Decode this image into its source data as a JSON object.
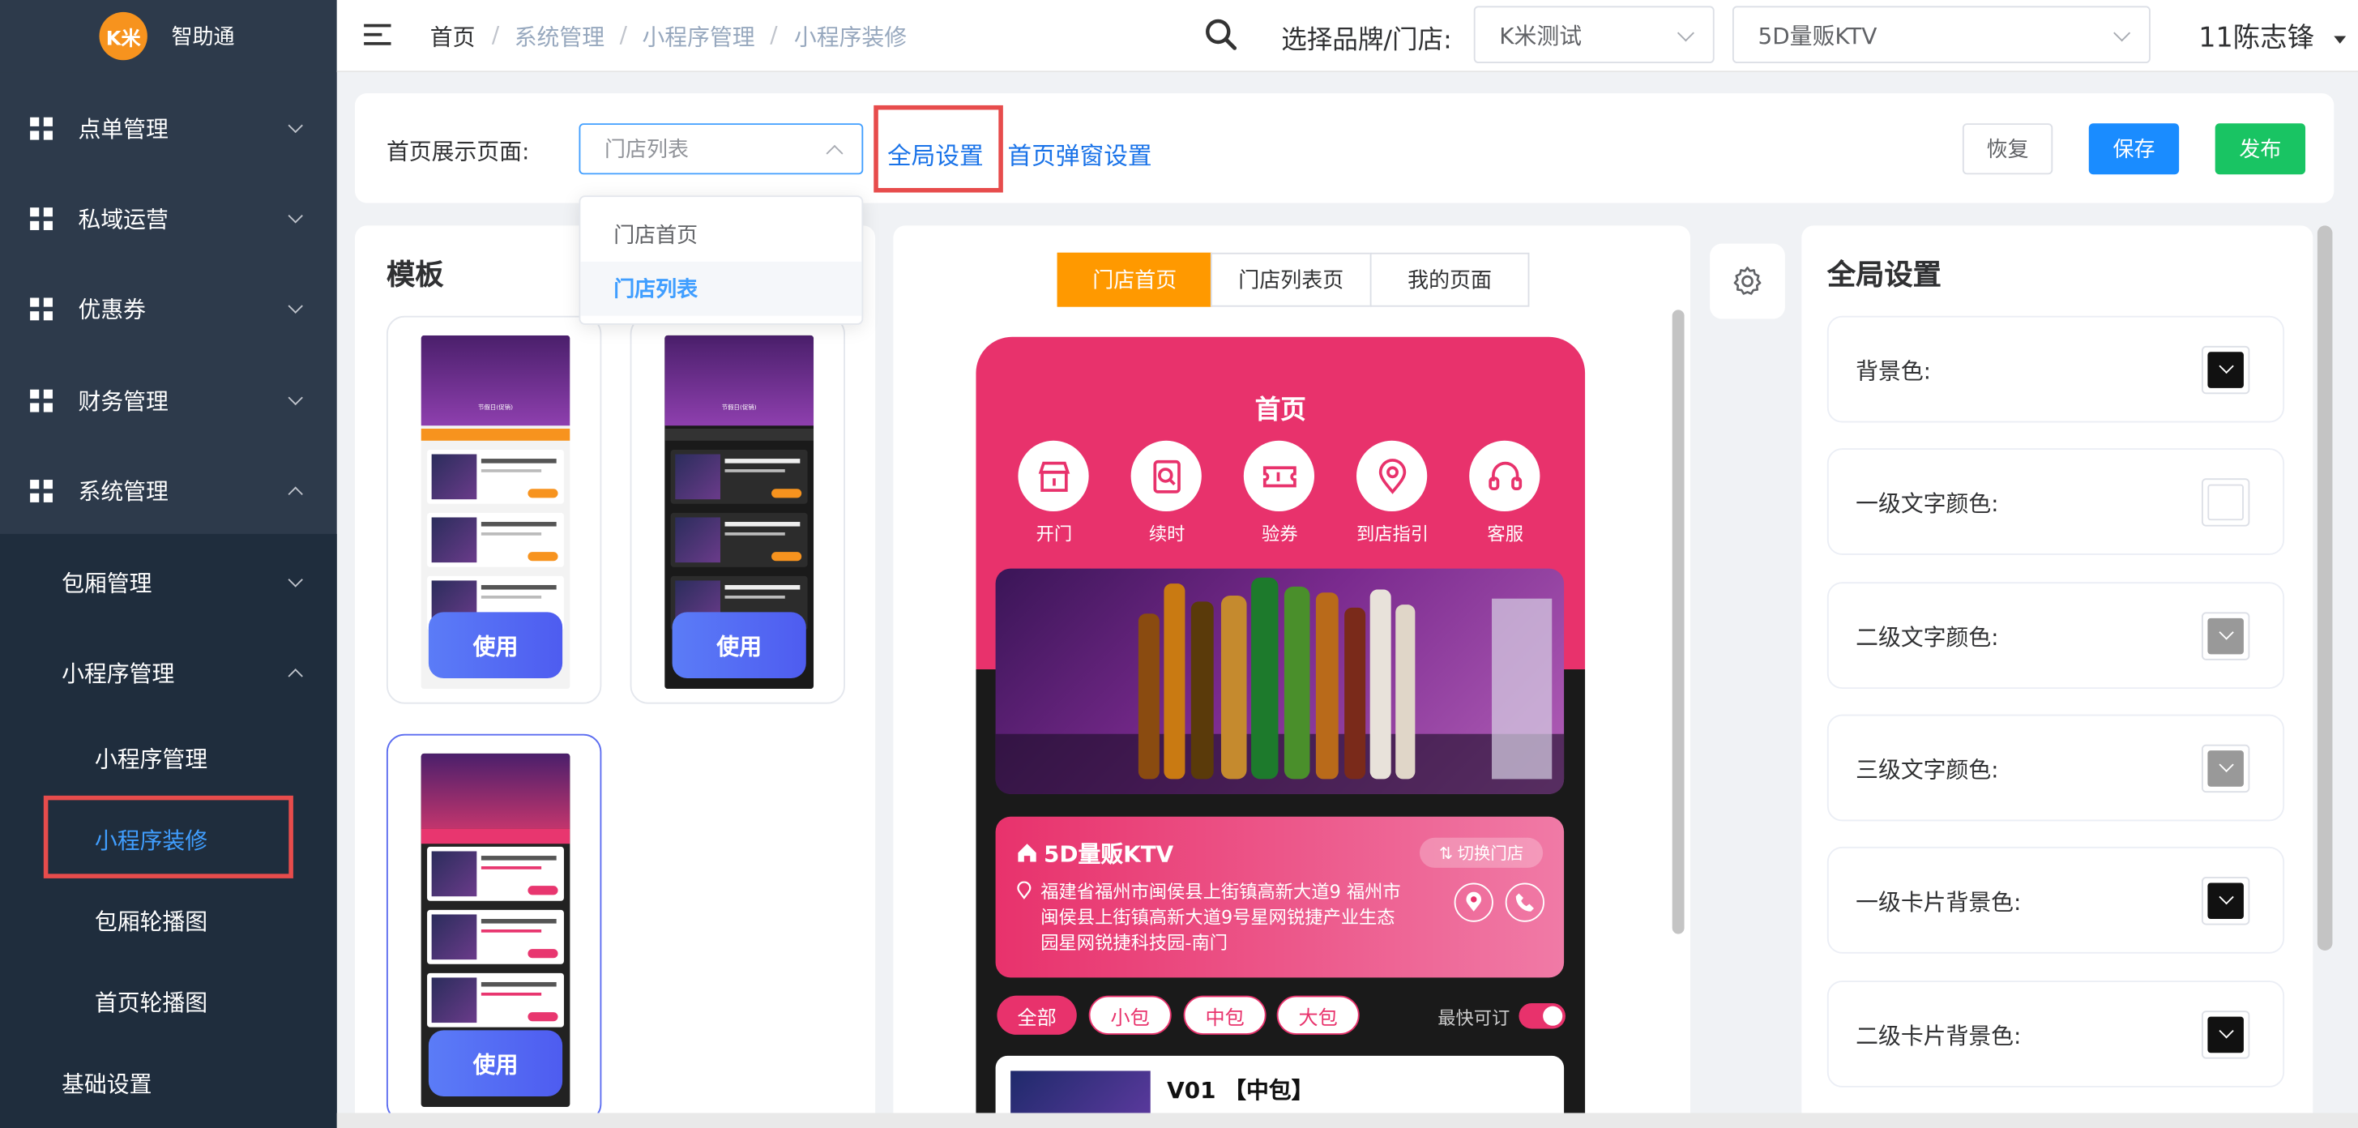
{
  "app": {
    "logo_text": "K米",
    "name": "智助通"
  },
  "sidebar": {
    "menus": [
      {
        "label": "点单管理"
      },
      {
        "label": "私域运营"
      },
      {
        "label": "优惠券"
      },
      {
        "label": "财务管理"
      },
      {
        "label": "系统管理"
      }
    ],
    "sub": [
      {
        "label": "包厢管理"
      },
      {
        "label": "小程序管理"
      },
      {
        "label": "小程序管理"
      },
      {
        "label": "小程序装修"
      },
      {
        "label": "包厢轮播图"
      },
      {
        "label": "首页轮播图"
      },
      {
        "label": "基础设置"
      }
    ]
  },
  "header": {
    "breadcrumbs": [
      "首页",
      "系统管理",
      "小程序管理",
      "小程序装修"
    ],
    "brand_label": "选择品牌/门店:",
    "brand_value": "K米测试",
    "store_value": "5D量贩KTV",
    "user": "11陈志锋"
  },
  "toolbar": {
    "page_label": "首页展示页面:",
    "page_value": "门店列表",
    "dropdown": [
      "门店首页",
      "门店列表"
    ],
    "global_link": "全局设置",
    "popup_link": "首页弹窗设置",
    "restore": "恢复",
    "save": "保存",
    "publish": "发布"
  },
  "templates": {
    "title": "模板",
    "use": "使用",
    "thumb_header": "节假日(促销)"
  },
  "preview": {
    "tabs": [
      "门店首页",
      "门店列表页",
      "我的页面"
    ],
    "phone_title": "首页",
    "icons": [
      {
        "label": "开门",
        "icon": "store-icon"
      },
      {
        "label": "续时",
        "icon": "search-doc-icon"
      },
      {
        "label": "验券",
        "icon": "ticket-icon"
      },
      {
        "label": "到店指引",
        "icon": "location-icon"
      },
      {
        "label": "客服",
        "icon": "headset-icon"
      }
    ],
    "store_name": "5D量贩KTV",
    "switch_store": "切换门店",
    "address": "福建省福州市闽侯县上街镇高新大道9 福州市闽侯县上街镇高新大道9号星网锐捷产业生态园星网锐捷科技园-南门",
    "filters": [
      "全部",
      "小包",
      "中包",
      "大包"
    ],
    "toggle_label": "最快可订",
    "room_title": "V01 【中包】"
  },
  "settings": {
    "title": "全局设置",
    "items": [
      {
        "label": "背景色:",
        "color": "#111111"
      },
      {
        "label": "一级文字颜色:",
        "color": "#ffffff"
      },
      {
        "label": "二级文字颜色:",
        "color": "#999999"
      },
      {
        "label": "三级文字颜色:",
        "color": "#999999"
      },
      {
        "label": "一级卡片背景色:",
        "color": "#111111"
      },
      {
        "label": "二级卡片背景色:",
        "color": "#111111"
      }
    ]
  },
  "colors": {
    "accent": "#409eff",
    "pink": "#e8366f",
    "orange": "#ff9900",
    "publish": "#19c463"
  }
}
